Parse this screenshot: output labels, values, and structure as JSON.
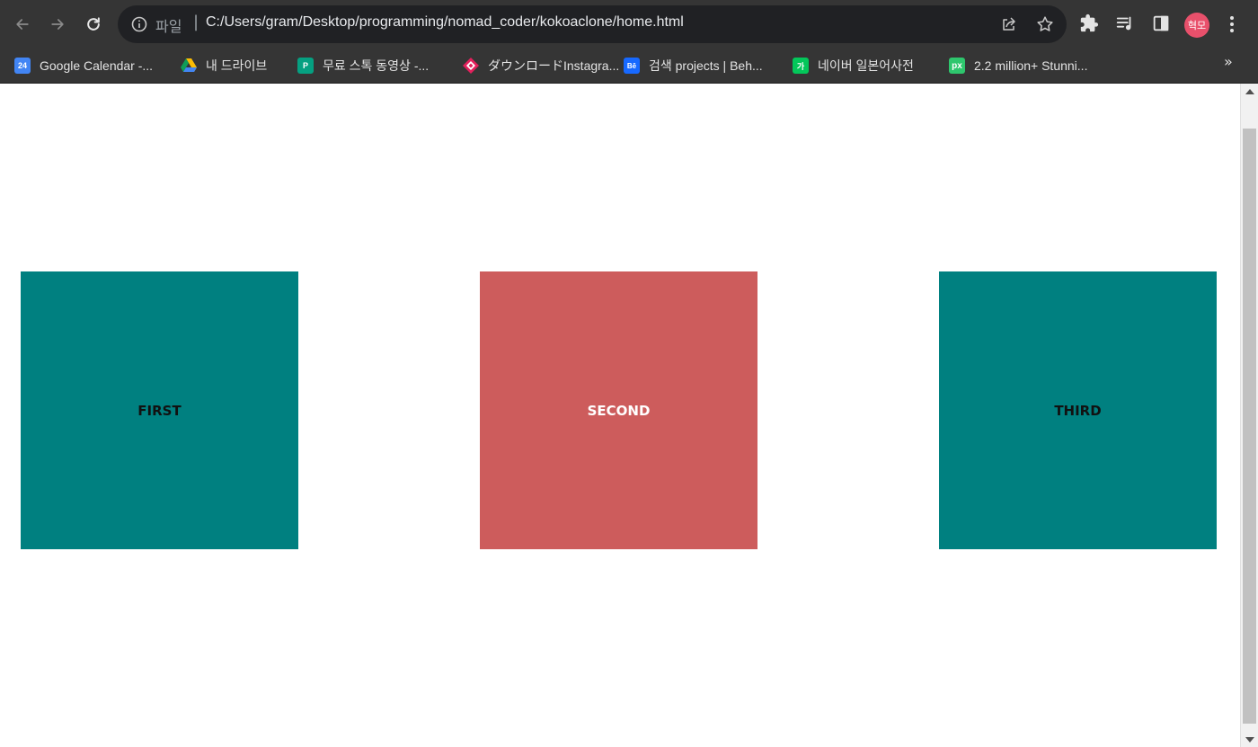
{
  "browser": {
    "address": {
      "scheme_label": "파일",
      "separator": "|",
      "url": "C:/Users/gram/Desktop/programming/nomad_coder/kokoaclone/home.html"
    },
    "profile_initials": "혁모",
    "bookmarks": [
      {
        "label": "Google Calendar -...",
        "favicon": "google-calendar-icon",
        "favicon_text": "24",
        "color": "#4285f4"
      },
      {
        "label": "내 드라이브",
        "favicon": "google-drive-icon",
        "favicon_text": "",
        "color": "#fbbc04"
      },
      {
        "label": "무료 스톡 동영상 -...",
        "favicon": "pexels-icon",
        "favicon_text": "P",
        "color": "#05a081"
      },
      {
        "label": "ダウンロードInstagra...",
        "favicon": "download-diamond-icon",
        "favicon_text": "",
        "color": "#e3205c"
      },
      {
        "label": "검색 projects | Beh...",
        "favicon": "behance-icon",
        "favicon_text": "Bē",
        "color": "#1769ff"
      },
      {
        "label": "네이버 일본어사전",
        "favicon": "naver-dictionary-icon",
        "favicon_text": "가",
        "color": "#03c75a"
      },
      {
        "label": "2.2 million+ Stunni...",
        "favicon": "pixabay-icon",
        "favicon_text": "px",
        "color": "#2ec66d"
      }
    ],
    "more_bookmarks": "»"
  },
  "page": {
    "boxes": [
      {
        "label": "FIRST",
        "color": "#008080"
      },
      {
        "label": "SECOND",
        "color": "#cd5c5c"
      },
      {
        "label": "THIRD",
        "color": "#008080"
      }
    ]
  }
}
